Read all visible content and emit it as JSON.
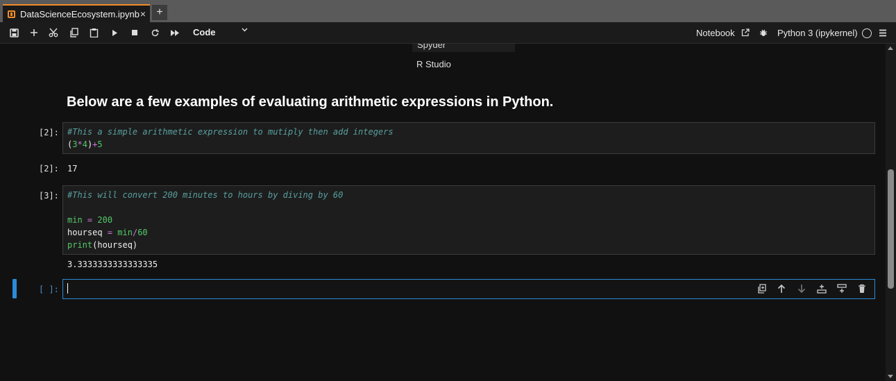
{
  "tab": {
    "title": "DataScienceEcosystem.ipynb",
    "close_label": "×",
    "add_label": "+"
  },
  "toolbar": {
    "cell_type": "Code",
    "notebook_label": "Notebook",
    "kernel_label": "Python 3 (ipykernel)"
  },
  "content": {
    "dropdown_remnant": "Spyder",
    "rstudio": "R Studio",
    "heading": "Below are a few examples of evaluating arithmetic expressions in Python."
  },
  "cells": [
    {
      "prompt": "[2]:",
      "comment": "#This a simple arithmetic expression to mutiply then add integers",
      "output_prompt": "[2]:",
      "output": "17"
    },
    {
      "prompt": "[3]:",
      "comment": "#This will convert 200 minutes to hours by diving by 60",
      "output": "3.3333333333333335"
    }
  ],
  "active_cell": {
    "prompt": "[ ]:"
  },
  "colors": {
    "accent": "#2a8bd8",
    "tab_accent": "#f28c28",
    "background": "#111111"
  }
}
